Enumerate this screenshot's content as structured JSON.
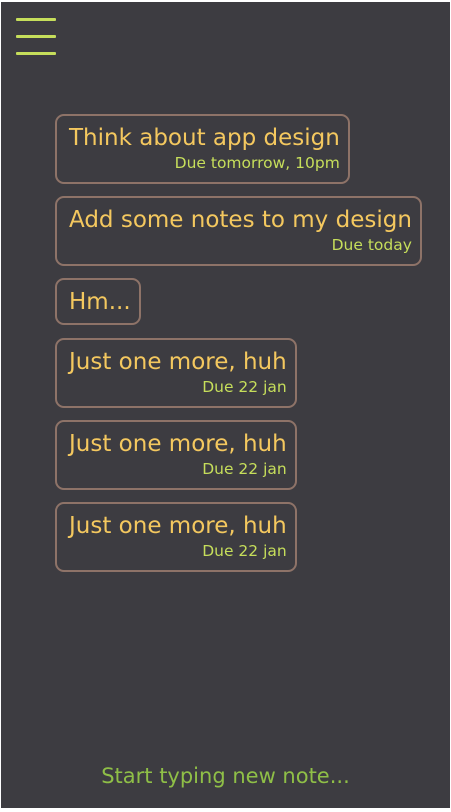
{
  "menu": {
    "icon": "hamburger-menu-icon"
  },
  "notes": [
    {
      "title": "Think about app design",
      "due": "Due tomorrow, 10pm"
    },
    {
      "title": "Add some notes to my design",
      "due": "Due today"
    },
    {
      "title": "Hm...",
      "due": ""
    },
    {
      "title": "Just one more, huh",
      "due": "Due 22 jan"
    },
    {
      "title": "Just one more, huh",
      "due": "Due 22 jan"
    },
    {
      "title": "Just one more, huh",
      "due": "Due 22 jan"
    }
  ],
  "new_note": {
    "placeholder": "Start typing new note..."
  },
  "colors": {
    "background": "#3d3c41",
    "note_title": "#f4c85f",
    "note_due": "#c6de5b",
    "note_border": "#8e7368",
    "accent": "#c6de5b",
    "placeholder": "#8fbf47"
  }
}
